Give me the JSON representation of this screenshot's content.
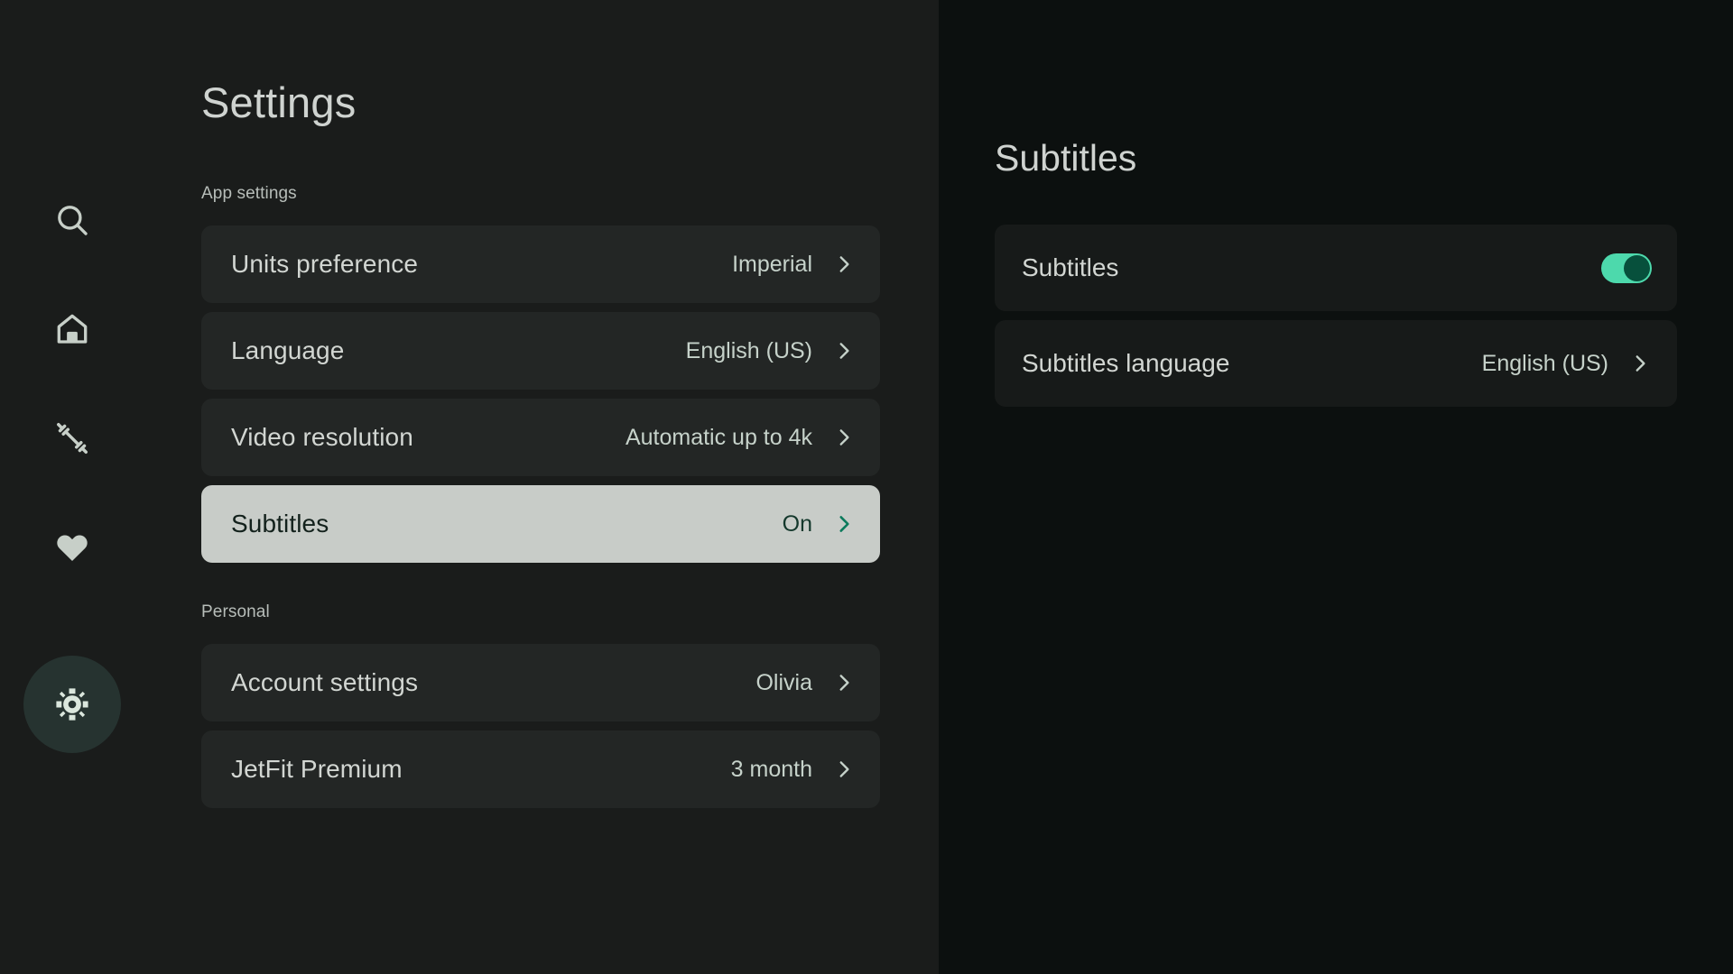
{
  "nav": {
    "items": [
      {
        "name": "search",
        "icon": "search-icon",
        "active": false
      },
      {
        "name": "home",
        "icon": "home-icon",
        "active": false
      },
      {
        "name": "workouts",
        "icon": "dumbbell-icon",
        "active": false
      },
      {
        "name": "favorites",
        "icon": "heart-icon",
        "active": false
      },
      {
        "name": "settings",
        "icon": "gear-icon",
        "active": true
      }
    ]
  },
  "left": {
    "title": "Settings",
    "sections": [
      {
        "label": "App settings",
        "rows": [
          {
            "label": "Units preference",
            "value": "Imperial",
            "highlighted": false
          },
          {
            "label": "Language",
            "value": "English (US)",
            "highlighted": false
          },
          {
            "label": "Video resolution",
            "value": "Automatic up to 4k",
            "highlighted": false
          },
          {
            "label": "Subtitles",
            "value": "On",
            "highlighted": true
          }
        ]
      },
      {
        "label": "Personal",
        "rows": [
          {
            "label": "Account settings",
            "value": "Olivia",
            "highlighted": false
          },
          {
            "label": "JetFit Premium",
            "value": "3 month",
            "highlighted": false
          }
        ]
      }
    ]
  },
  "right": {
    "title": "Subtitles",
    "rows": [
      {
        "label": "Subtitles",
        "control": "toggle",
        "value": "On"
      },
      {
        "label": "Subtitles language",
        "control": "chevron",
        "value": "English (US)"
      }
    ]
  },
  "colors": {
    "page_bg": "#1a1c1b",
    "detail_bg": "#0c100f",
    "card_bg": "#232625",
    "detail_card_bg": "#171a19",
    "highlight_bg": "#c8ccc8",
    "accent_toggle": "#4dd9ac",
    "accent_knob": "#07503c",
    "accent_chevron": "#0b7a5c",
    "text_primary": "#d2d6d2",
    "text_value": "#c6d2ca",
    "nav_active_bg": "#263330"
  }
}
